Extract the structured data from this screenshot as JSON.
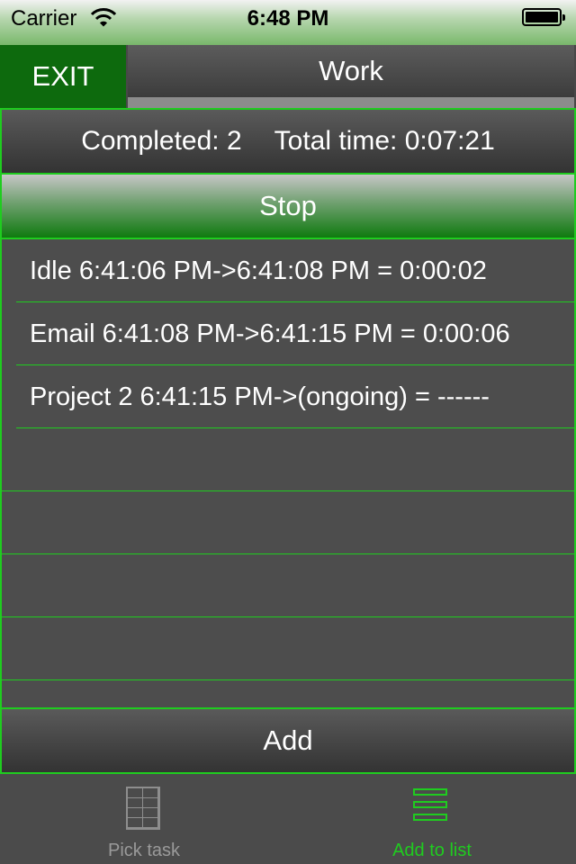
{
  "status_bar": {
    "carrier": "Carrier",
    "time": "6:48 PM"
  },
  "nav": {
    "exit_label": "EXIT",
    "title": "Work"
  },
  "summary": {
    "completed": "Completed: 2",
    "total_time": "Total time: 0:07:21"
  },
  "stop_label": "Stop",
  "entries": [
    "Idle 6:41:06 PM->6:41:08 PM = 0:00:02",
    "Email 6:41:08 PM->6:41:15 PM = 0:00:06",
    "Project 2 6:41:15 PM->(ongoing) = ------"
  ],
  "add_label": "Add",
  "tab_bar": {
    "tabs": [
      {
        "label": "Pick task",
        "icon": "grid-icon"
      },
      {
        "label": "Add to list",
        "icon": "list-icon"
      }
    ],
    "selected": "Add to list"
  },
  "colors": {
    "accent": "#1fcc1f",
    "exit_bg": "#0d6a0d",
    "background": "#484848"
  }
}
